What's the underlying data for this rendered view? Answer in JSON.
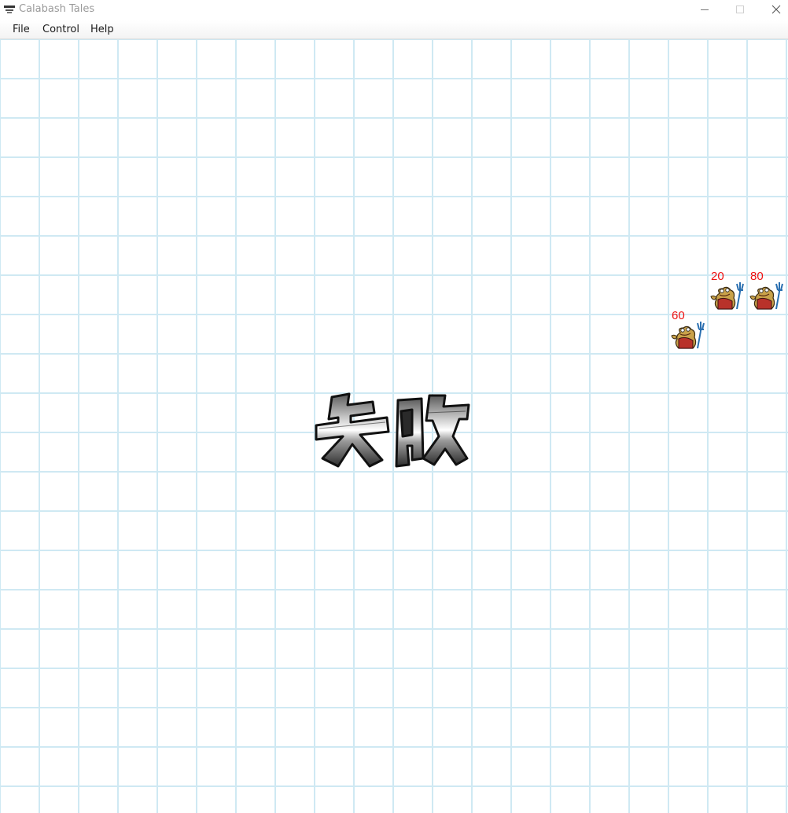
{
  "window": {
    "title": "Calabash Tales",
    "icon": "app-logo-icon",
    "controls": [
      "minimize-icon",
      "maximize-icon",
      "close-icon"
    ]
  },
  "menu": {
    "file": "File",
    "control": "Control",
    "help": "Help"
  },
  "board": {
    "columns": 20,
    "rows": 20,
    "grid_color": "#cfe9f3",
    "background": "#ffffff",
    "units": [
      {
        "hp": "20",
        "sprite": "toad-demon-icon"
      },
      {
        "hp": "80",
        "sprite": "toad-demon-icon"
      },
      {
        "hp": "60",
        "sprite": "toad-demon-icon"
      }
    ]
  },
  "result": {
    "text": "失败",
    "style": "metallic-gray"
  },
  "colors": {
    "hp_text": "#ee1111",
    "title_text": "#9a9a9a"
  }
}
